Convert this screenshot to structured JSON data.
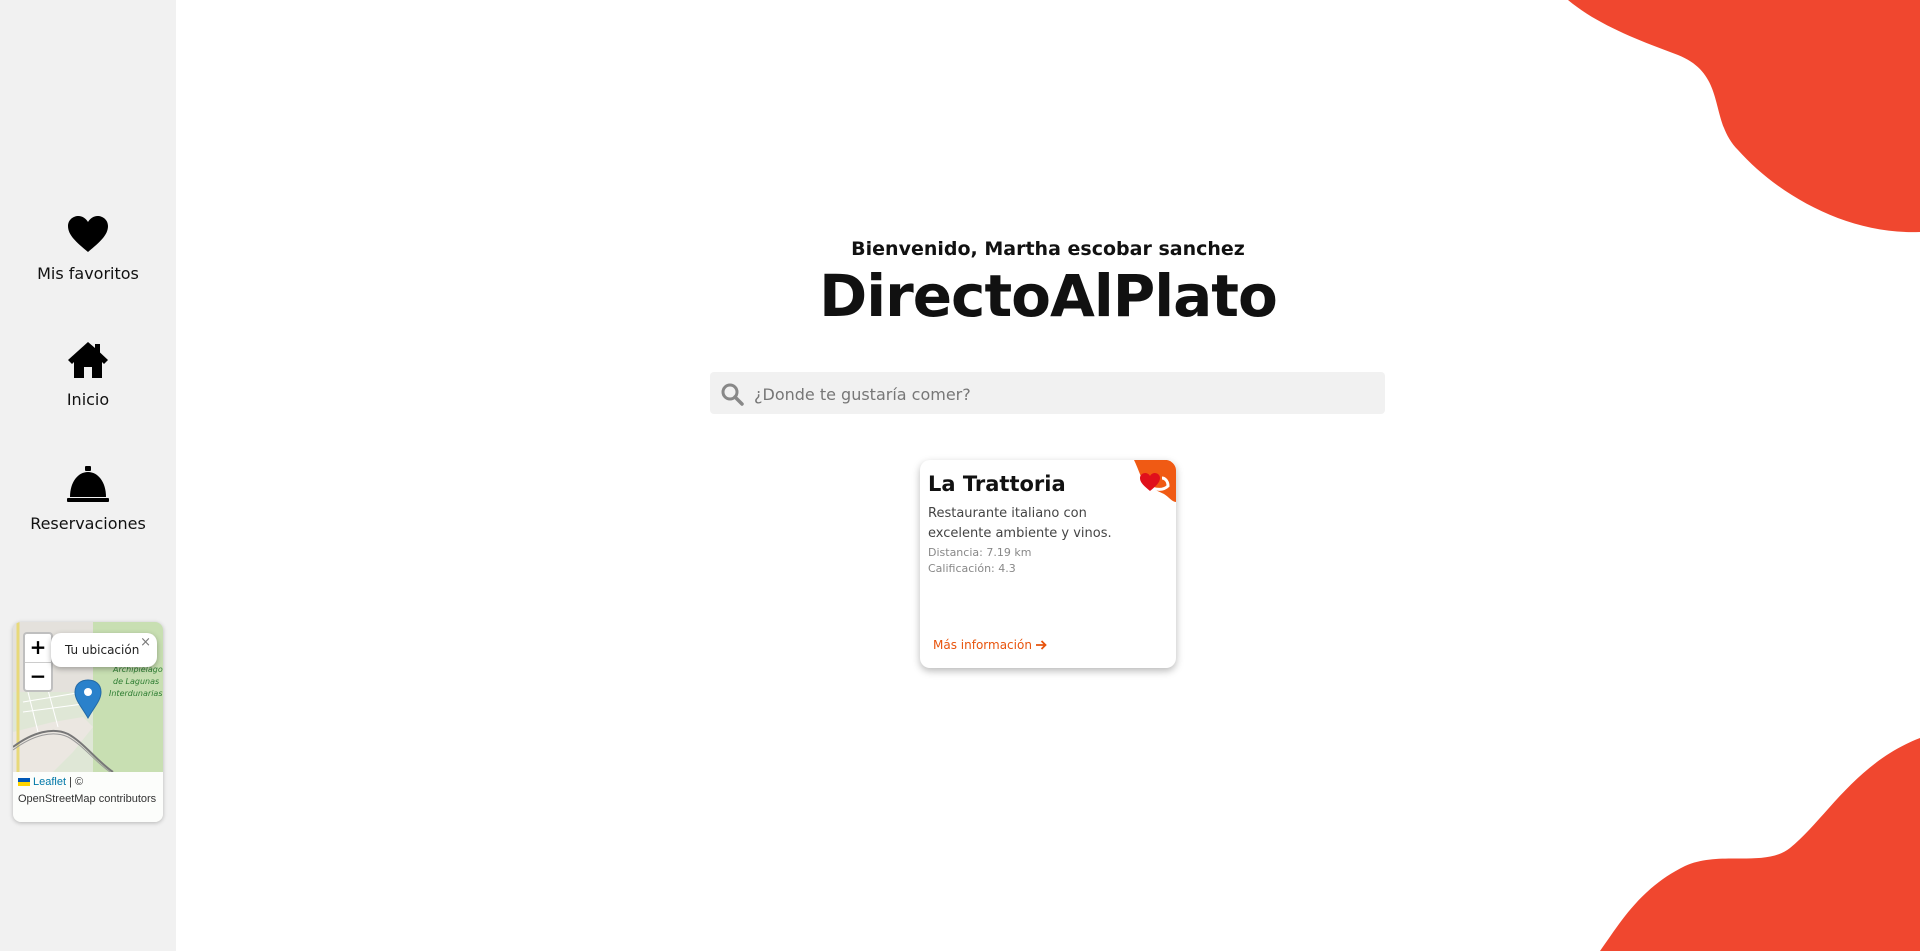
{
  "sidebar": {
    "items": [
      {
        "label": "Mis favoritos",
        "icon": "heart-icon"
      },
      {
        "label": "Inicio",
        "icon": "home-icon"
      },
      {
        "label": "Reservaciones",
        "icon": "bell-icon"
      }
    ]
  },
  "map": {
    "zoom_in": "+",
    "zoom_out": "−",
    "popup_text": "Tu ubicación",
    "popup_close": "×",
    "attribution_link": "Leaflet",
    "attribution_text": "| © OpenStreetMap contributors"
  },
  "main": {
    "greeting": "Bienvenido, Martha escobar sanchez",
    "brand": "DirectoAlPlato",
    "search_placeholder": "¿Donde te gustaría comer?"
  },
  "restaurants": [
    {
      "name": "La Trattoria",
      "description": "Restaurante italiano con excelente ambiente y vinos.",
      "distance": "Distancia: 7.19 km",
      "rating": "Calificación: 4.3",
      "more": "Más información",
      "favorite": true
    }
  ],
  "colors": {
    "accent": "#f0472f",
    "badge": "#f05a14",
    "heart": "#e0101b",
    "link": "#e8540d"
  }
}
